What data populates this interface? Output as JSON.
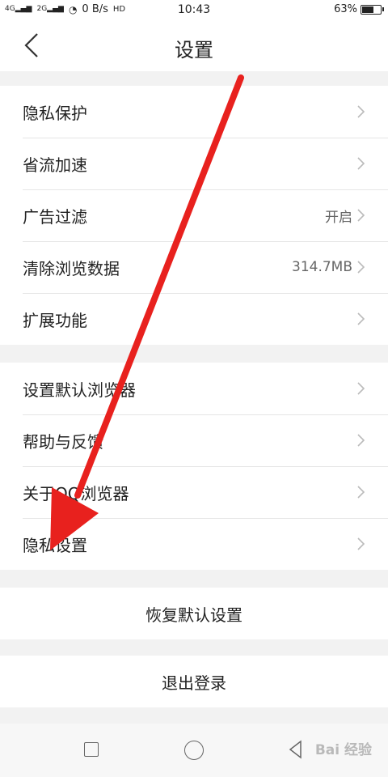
{
  "status_bar": {
    "network_left": "4G",
    "network_right": "2G",
    "speed": "0 B/s",
    "hd": "HD",
    "time": "10:43",
    "battery": "63%",
    "battery_level": 0.63
  },
  "header": {
    "title": "设置"
  },
  "group1": [
    {
      "label": "隐私保护",
      "value": ""
    },
    {
      "label": "省流加速",
      "value": ""
    },
    {
      "label": "广告过滤",
      "value": "开启"
    },
    {
      "label": "清除浏览数据",
      "value": "314.7MB"
    },
    {
      "label": "扩展功能",
      "value": ""
    }
  ],
  "group2": [
    {
      "label": "设置默认浏览器",
      "value": ""
    },
    {
      "label": "帮助与反馈",
      "value": ""
    },
    {
      "label": "关于QQ浏览器",
      "value": ""
    },
    {
      "label": "隐私设置",
      "value": ""
    }
  ],
  "buttons": {
    "restore": "恢复默认设置",
    "logout": "退出登录"
  },
  "watermark": "Bai 经验",
  "colors": {
    "annotation_arrow": "#e8211e"
  }
}
